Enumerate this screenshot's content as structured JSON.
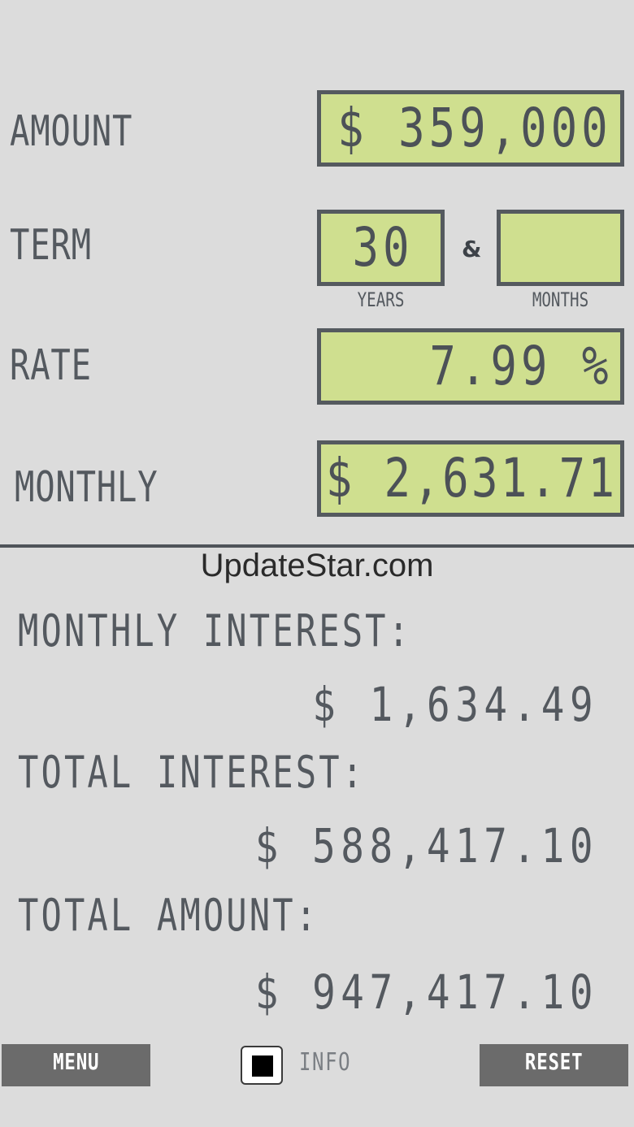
{
  "inputs": {
    "amount": {
      "label": "AMOUNT",
      "value": "$ 359,000"
    },
    "term": {
      "label": "TERM",
      "years_value": "30",
      "months_value": "",
      "separator": "&",
      "years_label": "YEARS",
      "months_label": "MONTHS"
    },
    "rate": {
      "label": "RATE",
      "value": "7.99 %"
    },
    "monthly": {
      "label": "MONTHLY",
      "value": "$ 2,631.71"
    }
  },
  "watermark": "UpdateStar.com",
  "results": {
    "monthly_interest": {
      "label": "MONTHLY INTEREST:",
      "value": "$ 1,634.49"
    },
    "total_interest": {
      "label": "TOTAL INTEREST:",
      "value": "$ 588,417.10"
    },
    "total_amount": {
      "label": "TOTAL AMOUNT:",
      "value": "$ 947,417.10"
    }
  },
  "footer": {
    "menu_label": "MENU",
    "info_label": "INFO",
    "info_checked": true,
    "reset_label": "RESET"
  },
  "colors": {
    "background": "#dcdcdc",
    "lcd_fill": "#cfdf8f",
    "lcd_border": "#555a5f",
    "button": "#6b6b6b"
  }
}
